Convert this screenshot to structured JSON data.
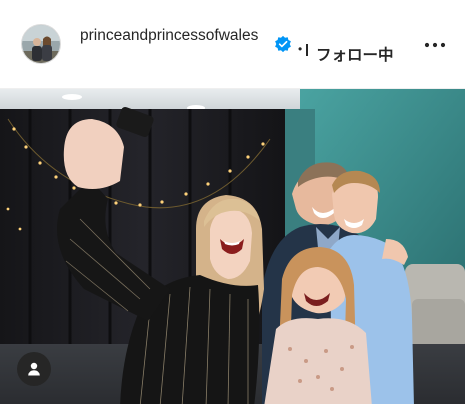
{
  "post": {
    "username": "princeandprincessofwales",
    "verified": true,
    "follow_dot": "•",
    "follow_status": "フォロー中"
  },
  "icons": {
    "avatar": "profile-photo-avatar",
    "verified": "verified-badge-icon",
    "more": "more-options-icon",
    "user_tag": "user-tag-icon"
  },
  "colors": {
    "verified_blue": "#0095f6",
    "text": "#262626",
    "teal_wall": "#3f8f8e"
  }
}
